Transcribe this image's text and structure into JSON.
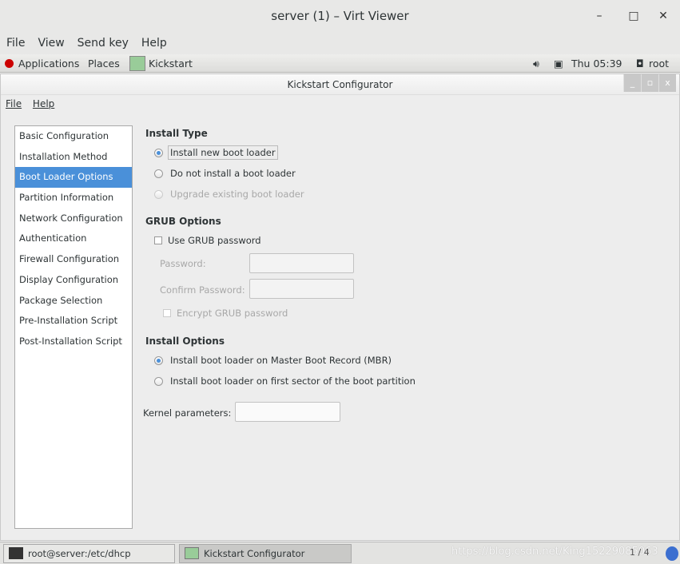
{
  "window": {
    "title": "server (1) – Virt Viewer",
    "minimize": "–",
    "maximize": "□",
    "close": "✕"
  },
  "menubar": [
    "File",
    "View",
    "Send key",
    "Help"
  ],
  "panel": {
    "applications": "Applications",
    "places": "Places",
    "app": "Kickstart",
    "time": "Thu 05:39",
    "user": "root"
  },
  "ks": {
    "title": "Kickstart Configurator",
    "menu": [
      "File",
      "Help"
    ],
    "sidebar": [
      "Basic Configuration",
      "Installation Method",
      "Boot Loader Options",
      "Partition Information",
      "Network Configuration",
      "Authentication",
      "Firewall Configuration",
      "Display Configuration",
      "Package Selection",
      "Pre-Installation Script",
      "Post-Installation Script"
    ],
    "selected": "Boot Loader Options",
    "install_type": {
      "heading": "Install Type",
      "options": [
        "Install new boot loader",
        "Do not install a boot loader",
        "Upgrade existing boot loader"
      ]
    },
    "grub": {
      "heading": "GRUB Options",
      "use_password": "Use GRUB password",
      "password": "Password:",
      "confirm": "Confirm Password:",
      "encrypt": "Encrypt GRUB password"
    },
    "install_options": {
      "heading": "Install Options",
      "options": [
        "Install boot loader on Master Boot Record (MBR)",
        "Install boot loader on first sector of the boot partition"
      ]
    },
    "kernel_label": "Kernel parameters:",
    "kernel_value": ""
  },
  "taskbar": {
    "tasks": [
      "root@server:/etc/dhcp",
      "Kickstart Configurator"
    ],
    "pager": "1 / 4",
    "watermark": "https://blog.csdn.net/King15229085063"
  },
  "colors": {
    "accent": "#4a90d9"
  }
}
